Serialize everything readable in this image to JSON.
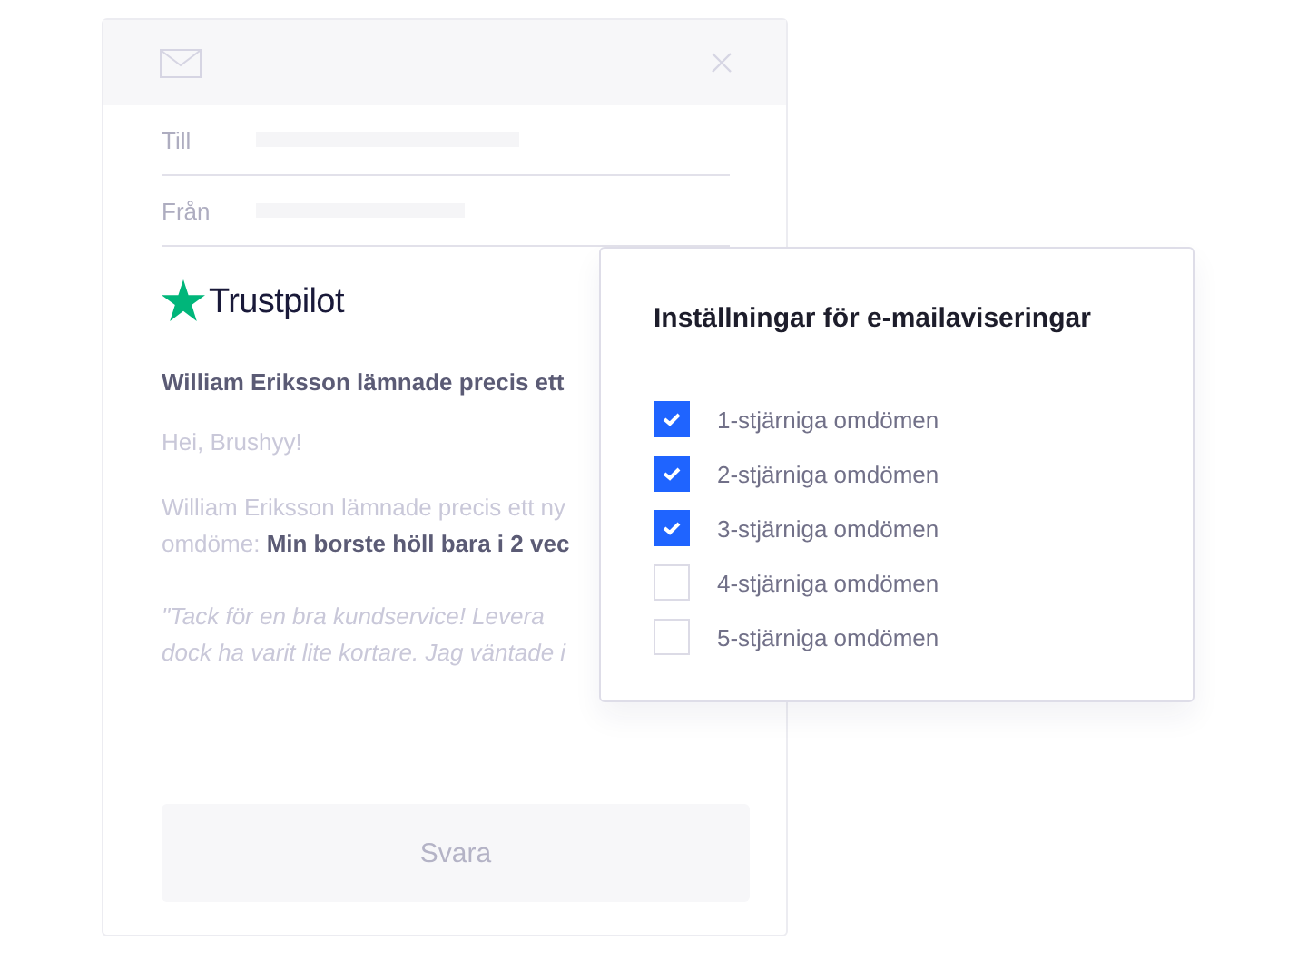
{
  "email": {
    "fields": [
      {
        "label": "Till"
      },
      {
        "label": "Från"
      }
    ],
    "brand": "Trustpilot",
    "subject": "William Eriksson lämnade precis ett",
    "greeting": "Hei, Brushyy!",
    "body_lines": [
      "William Eriksson lämnade precis ett ny",
      "omdöme: **Min borste höll bara i 2 vec**"
    ],
    "quote_lines": [
      "\"Tack för en bra kundservice! Levera",
      "dock ha varit lite kortare. Jag väntade i"
    ],
    "reply_button": "Svara"
  },
  "settings": {
    "title": "Inställningar för e-mailaviseringar",
    "options": [
      {
        "label": "1-stjärniga omdömen",
        "checked": true
      },
      {
        "label": "2-stjärniga omdömen",
        "checked": true
      },
      {
        "label": "3-stjärniga omdömen",
        "checked": true
      },
      {
        "label": "4-stjärniga omdömen",
        "checked": false
      },
      {
        "label": "5-stjärniga omdömen",
        "checked": false
      }
    ]
  }
}
